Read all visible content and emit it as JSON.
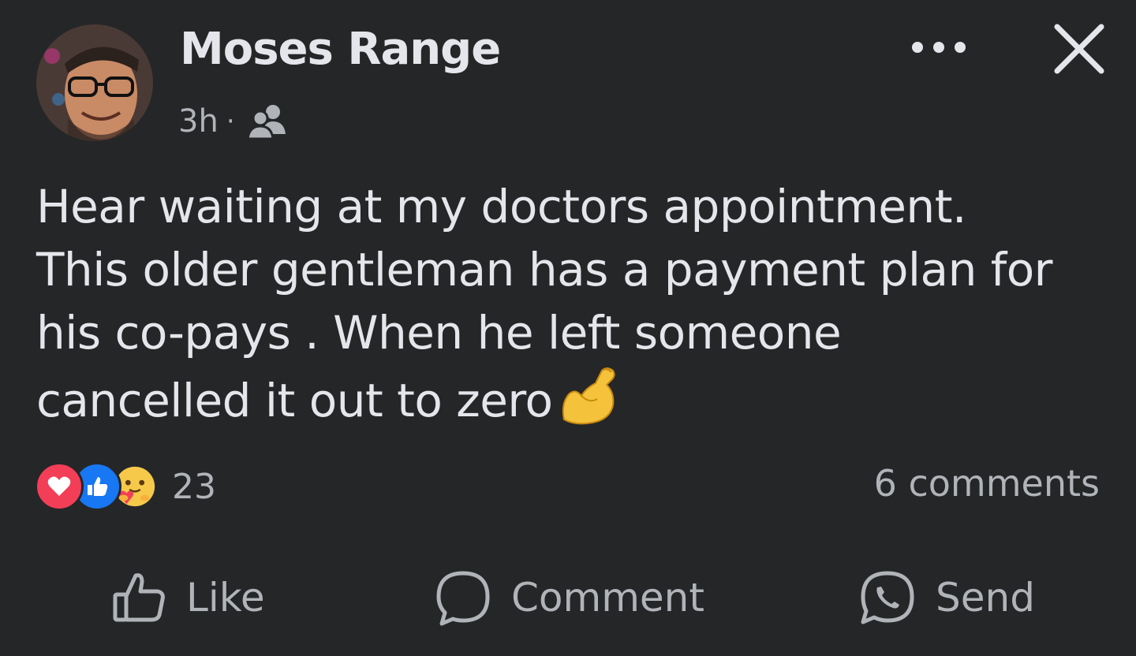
{
  "post": {
    "author": "Moses Range",
    "time": "3h",
    "separator": "·",
    "audience_icon": "friends-icon",
    "text_lines": [
      "Hear waiting at my doctors appointment.",
      "This older gentleman has a payment plan for",
      "his co-pays . When he left someone",
      "cancelled it out to zero"
    ],
    "text_emoji": "flexed-biceps-emoji"
  },
  "header": {
    "more_icon": "more-dots-icon",
    "close_icon": "close-icon"
  },
  "reactions": {
    "types": [
      "love",
      "like",
      "care"
    ],
    "count": "23"
  },
  "comments": {
    "label": "6 comments"
  },
  "actions": {
    "like_label": "Like",
    "comment_label": "Comment",
    "send_label": "Send"
  },
  "colors": {
    "background": "#252628",
    "primary_text": "#e4e6eb",
    "secondary_text": "#b0b3b8",
    "love": "#f33e58",
    "like": "#1877f2"
  }
}
